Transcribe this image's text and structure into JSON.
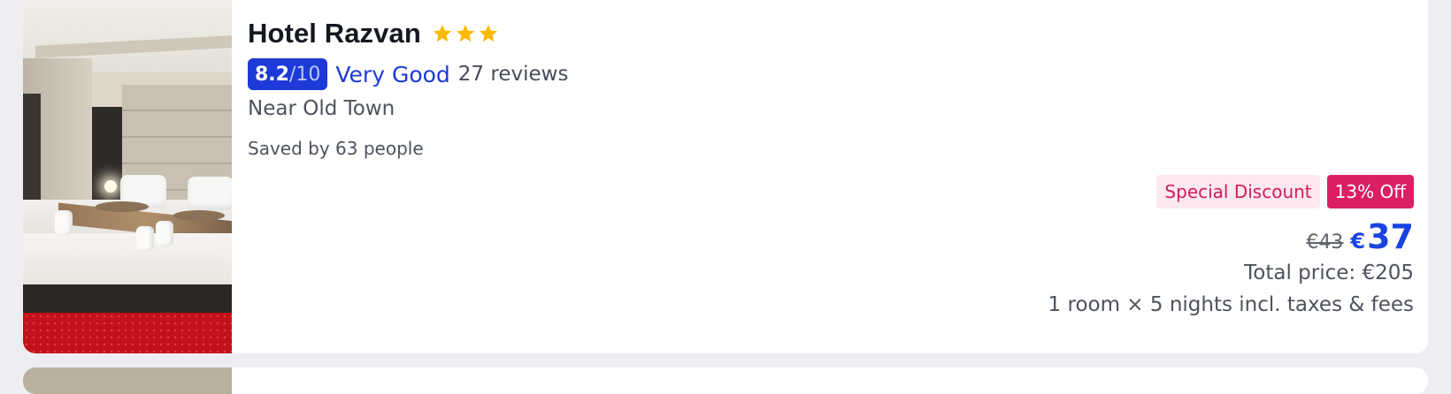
{
  "hotel": {
    "name": "Hotel Razvan",
    "stars": 3,
    "star_color": "#fbb900",
    "rating": {
      "score": "8.2",
      "denominator": "/10",
      "word": "Very Good",
      "reviews": "27 reviews",
      "badge_color": "#1d3ad8"
    },
    "location": "Near Old Town",
    "saved": "Saved by 63 people",
    "photo_icon": "hotel-room-photo"
  },
  "pricing": {
    "special_label": "Special Discount",
    "discount_label": "13% Off",
    "old_price": "€43",
    "currency": "€",
    "price": "37",
    "total": "Total price: €205",
    "details": "1 room × 5 nights incl. taxes & fees",
    "accent_color": "#1a44e0",
    "discount_color": "#db1f63"
  }
}
